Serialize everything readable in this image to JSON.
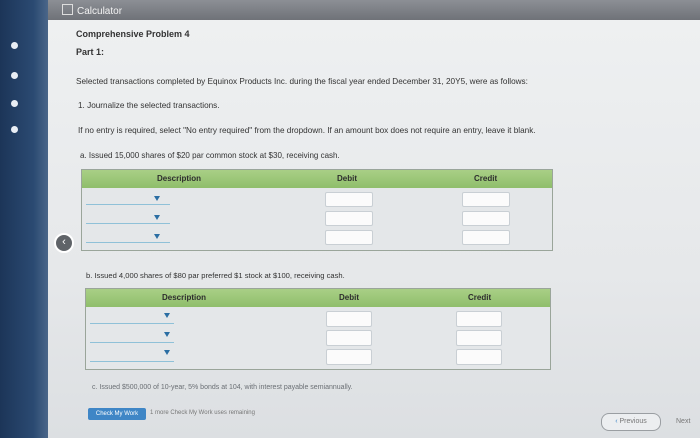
{
  "window": {
    "title": "Calculator"
  },
  "problem": {
    "title": "Comprehensive Problem 4",
    "part": "Part 1:",
    "intro": "Selected transactions completed by Equinox Products Inc. during the fiscal year ended December 31, 20Y5, were as follows:",
    "step1": "1.  Journalize the selected transactions.",
    "instructions": "If no entry is required, select \"No entry required\" from the dropdown. If an amount box does not require an entry, leave it blank."
  },
  "transactions": {
    "a": "a.  Issued 15,000 shares of $20 par common stock at $30, receiving cash.",
    "b": "b.  Issued 4,000 shares of $80 par preferred $1 stock at $100, receiving cash.",
    "c": "c.  Issued $500,000 of 10-year, 5% bonds at 104, with interest payable semiannually."
  },
  "table_headers": {
    "description": "Description",
    "debit": "Debit",
    "credit": "Credit"
  },
  "footer": {
    "check_label": "Check My Work",
    "remaining": "1 more Check My Work uses remaining",
    "previous": "Previous",
    "next": "Next"
  }
}
